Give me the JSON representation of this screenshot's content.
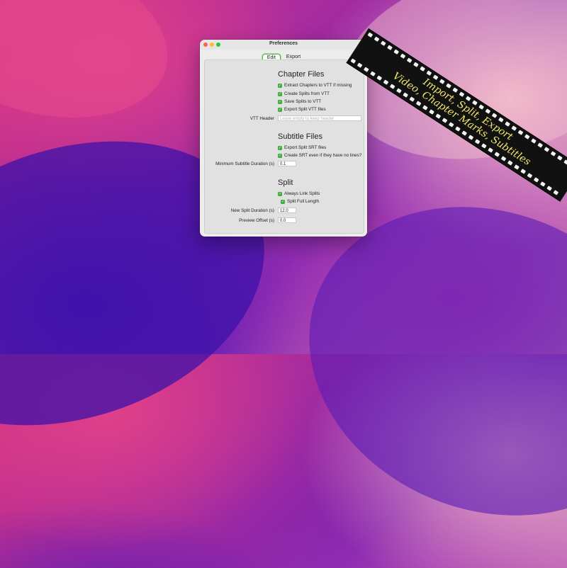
{
  "window": {
    "title": "Preferences",
    "tabs": [
      {
        "label": "Edit",
        "active": true
      },
      {
        "label": "Export",
        "active": false
      }
    ]
  },
  "chapter_files": {
    "heading": "Chapter Files",
    "options": [
      {
        "label": "Extract Chapters to VTT if missing",
        "checked": true
      },
      {
        "label": "Create Splits from VTT",
        "checked": true
      },
      {
        "label": "Save Splits to VTT",
        "checked": true
      },
      {
        "label": "Export Split VTT files",
        "checked": true
      }
    ],
    "vtt_header_label": "VTT Header",
    "vtt_header_placeholder": "Leave empty to keep header"
  },
  "subtitle_files": {
    "heading": "Subtitle Files",
    "options": [
      {
        "label": "Export Split SRT files",
        "checked": true
      },
      {
        "label": "Create SRT even if they have no lines?",
        "checked": true
      }
    ],
    "min_duration_label": "Minimum Subtitle Duration (s)",
    "min_duration_value": "0.1"
  },
  "split": {
    "heading": "Split",
    "options": [
      {
        "label": "Always Link Splits",
        "checked": true
      },
      {
        "label": "Split Full Length",
        "checked": true
      }
    ],
    "new_split_duration_label": "New Split Duration (s)",
    "new_split_duration_value": "12.0",
    "preview_offset_label": "Preview Offset (s)",
    "preview_offset_value": "0.0"
  },
  "banner": {
    "line1": "Import, Split, Export",
    "line2": "Video, Chapter Marks, Subtitles"
  },
  "colors": {
    "checkbox": "#3fae3f",
    "banner_text": "#f3e76a",
    "tab_focus": "#59b64a"
  }
}
